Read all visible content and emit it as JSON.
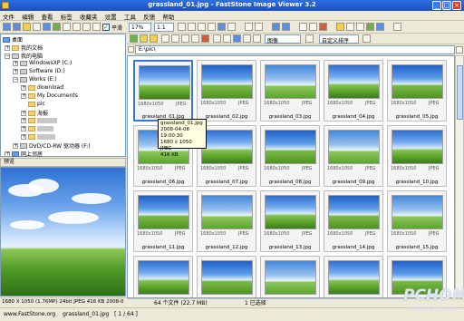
{
  "window": {
    "title": "grassland_01.jpg - FastStone Image Viewer 3.2"
  },
  "menu": [
    "文件",
    "编辑",
    "查看",
    "标签",
    "收藏夹",
    "设置",
    "工具",
    "反馈",
    "帮助"
  ],
  "toolbar": {
    "zoom_value": "17%",
    "ratio_value": "1:1",
    "checkbox_label": "平滑"
  },
  "tree": {
    "items": [
      {
        "label": "桌面",
        "expander": ""
      },
      {
        "label": "我的文档",
        "expander": "+"
      },
      {
        "label": "我的电脑",
        "expander": "−"
      },
      {
        "label": "WindowsXP (C:)",
        "expander": "+"
      },
      {
        "label": "Software (D:)",
        "expander": "+"
      },
      {
        "label": "Works (E:)",
        "expander": "−"
      },
      {
        "label": "download",
        "expander": "+"
      },
      {
        "label": "My Documents",
        "expander": "+"
      },
      {
        "label": "pic",
        "expander": ""
      },
      {
        "label": "海报",
        "expander": "+"
      },
      {
        "label": "",
        "expander": "+"
      },
      {
        "label": "",
        "expander": "+"
      },
      {
        "label": "",
        "expander": "+"
      },
      {
        "label": "DVD/CD-RW 驱动器 (F:)",
        "expander": "+"
      },
      {
        "label": "网上邻居",
        "expander": "+"
      }
    ]
  },
  "preview": {
    "header": "预览",
    "status": "1680 X 1050 (1.76MP)   24bit JPEG   416 KB   2008-0"
  },
  "right_toolbar": {
    "sort_select": "图像",
    "sort_order": "自定义排序"
  },
  "address": {
    "path": "E:\\pic\\"
  },
  "thumbnails": [
    {
      "name": "grassland_01.jpg",
      "dims": "1680x1050",
      "fmt": "JPEG"
    },
    {
      "name": "grassland_02.jpg",
      "dims": "1680x1050",
      "fmt": "JPEG"
    },
    {
      "name": "grassland_03.jpg",
      "dims": "1680x1050",
      "fmt": "JPEG"
    },
    {
      "name": "grassland_04.jpg",
      "dims": "1680x1050",
      "fmt": "JPEG"
    },
    {
      "name": "grassland_05.jpg",
      "dims": "1680x1050",
      "fmt": "JPEG"
    },
    {
      "name": "grassland_06.jpg",
      "dims": "1680x1050",
      "fmt": "JPEG"
    },
    {
      "name": "grassland_07.jpg",
      "dims": "1680x1050",
      "fmt": "JPEG"
    },
    {
      "name": "grassland_08.jpg",
      "dims": "1680x1050",
      "fmt": "JPEG"
    },
    {
      "name": "grassland_09.jpg",
      "dims": "1680x1050",
      "fmt": "JPEG"
    },
    {
      "name": "grassland_10.jpg",
      "dims": "1680x1050",
      "fmt": "JPEG"
    },
    {
      "name": "grassland_11.jpg",
      "dims": "1680x1050",
      "fmt": "JPEG"
    },
    {
      "name": "grassland_12.jpg",
      "dims": "1680x1050",
      "fmt": "JPEG"
    },
    {
      "name": "grassland_13.jpg",
      "dims": "1680x1050",
      "fmt": "JPEG"
    },
    {
      "name": "grassland_14.jpg",
      "dims": "1680x1050",
      "fmt": "JPEG"
    },
    {
      "name": "grassland_15.jpg",
      "dims": "1680x1050",
      "fmt": "JPEG"
    }
  ],
  "tooltip": {
    "line1": "grassland_01.jpg",
    "line2": "2008-04-08  19:00:30",
    "line3": "1680 x 1050   JPEG",
    "line4": "416 KB"
  },
  "status_right": {
    "count": "64 个文件 (22.7 MB)",
    "selected": "1 已选择"
  },
  "bottom": {
    "site": "www.FastStone.org",
    "file": "grassland_01.jpg",
    "page": "[ 1 / 64 ]"
  },
  "watermark": {
    "main": "PCHOME",
    "sub": "WWW.PCHOME.NET"
  }
}
